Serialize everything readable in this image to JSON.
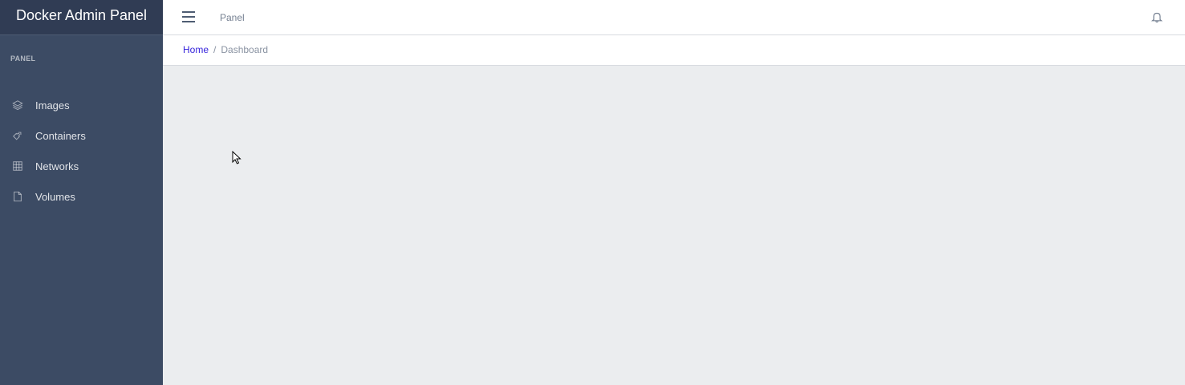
{
  "sidebar": {
    "brand": "Docker Admin Panel",
    "section_title": "PANEL",
    "items": [
      {
        "label": "Images",
        "icon": "layers-icon"
      },
      {
        "label": "Containers",
        "icon": "puzzle-icon"
      },
      {
        "label": "Networks",
        "icon": "grid-icon"
      },
      {
        "label": "Volumes",
        "icon": "file-icon"
      }
    ]
  },
  "header": {
    "nav_link": "Panel",
    "menu_icon": "hamburger-icon",
    "notification_icon": "bell-icon"
  },
  "breadcrumb": {
    "home": "Home",
    "separator": "/",
    "current": "Dashboard"
  },
  "colors": {
    "sidebar_bg": "#3c4b64",
    "brand_bg": "#303c54",
    "link": "#321fdb",
    "content_bg": "#ebedef"
  }
}
